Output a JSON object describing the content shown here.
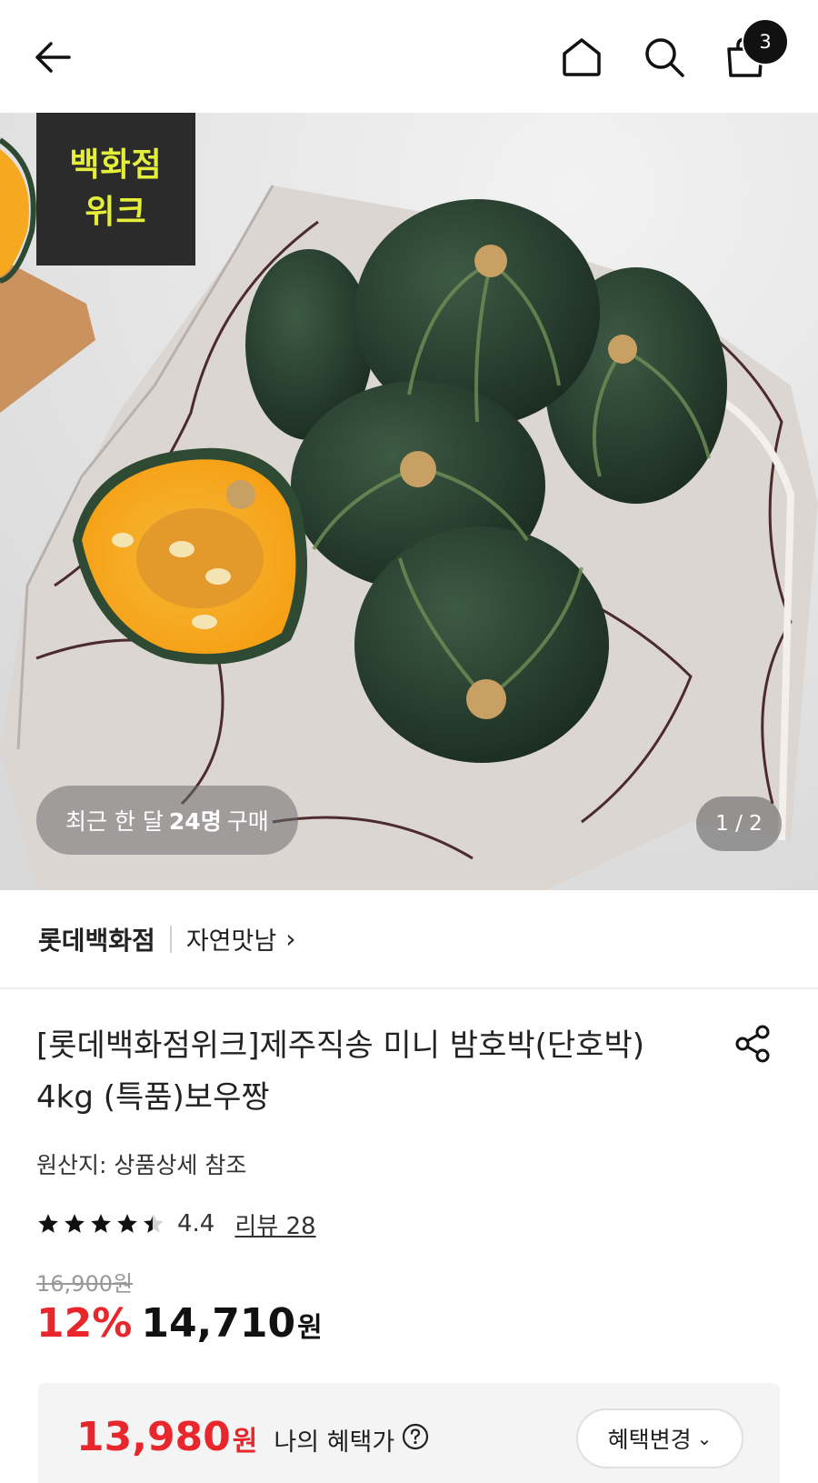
{
  "header": {
    "back_icon": "arrow-left-icon",
    "home_icon": "home-icon",
    "search_icon": "search-icon",
    "cart_icon": "shopping-bag-icon",
    "cart_count": "3"
  },
  "hero": {
    "promo_tag_line1": "백화점",
    "promo_tag_line2": "위크",
    "buyers_prefix": "최근 한 달",
    "buyers_count": "24명",
    "buyers_suffix": "구매",
    "page_indicator": "1 / 2"
  },
  "brand": {
    "name": "롯데백화점",
    "sub": "자연맛남",
    "chevron": "›"
  },
  "product": {
    "title": "[롯데백화점위크]제주직송 미니 밤호박(단호박) 4kg (특품)보우짱",
    "origin": "원산지: 상품상세 참조",
    "rating": "4.4",
    "rating_stars": 4.4,
    "review_label": "리뷰 28",
    "original_price": "16,900원",
    "discount": "12%",
    "price": "14,710",
    "price_unit": "원"
  },
  "benefit": {
    "price": "13,980",
    "unit": "원",
    "label": "나의 혜택가",
    "button_label": "혜택변경"
  },
  "colors": {
    "accent_red": "#e8262b",
    "promo_yellow": "#e5ef3a"
  }
}
